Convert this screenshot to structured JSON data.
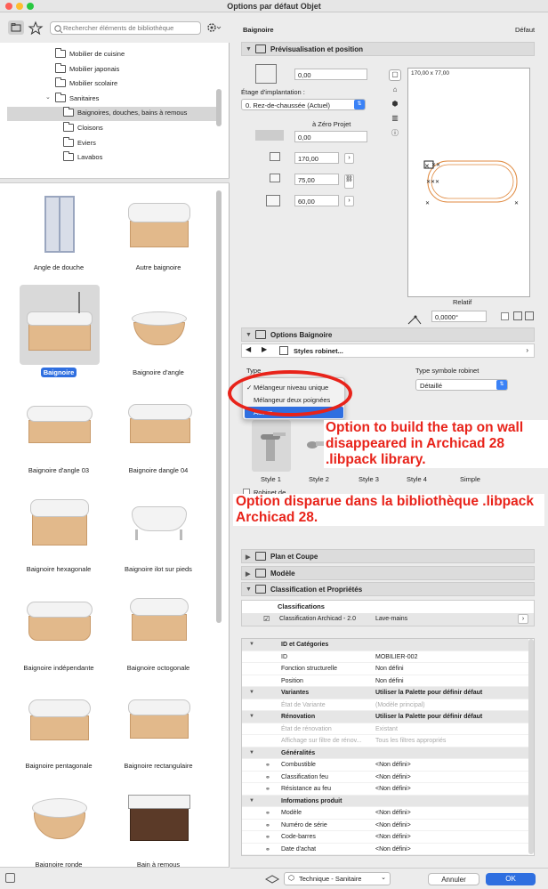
{
  "window": {
    "title": "Options par défaut Objet"
  },
  "library": {
    "search_placeholder": "Rechercher éléments de bibliothèque",
    "tree": [
      {
        "label": "Mobilier de cuisine"
      },
      {
        "label": "Mobilier japonais"
      },
      {
        "label": "Mobilier scolaire"
      },
      {
        "label": "Sanitaires"
      },
      {
        "label": "Baignoires, douches, bains à remous"
      },
      {
        "label": "Cloisons"
      },
      {
        "label": "Eviers"
      },
      {
        "label": "Lavabos"
      }
    ],
    "items": [
      {
        "label": "Angle de douche"
      },
      {
        "label": "Autre baignoire"
      },
      {
        "label": "Baignoire"
      },
      {
        "label": "Baignoire d'angle"
      },
      {
        "label": "Baignoire d'angle 03"
      },
      {
        "label": "Baignoire dangle 04"
      },
      {
        "label": "Baignoire hexagonale"
      },
      {
        "label": "Baignoire ilot sur pieds"
      },
      {
        "label": "Baignoire indépendante"
      },
      {
        "label": "Baignoire octogonale"
      },
      {
        "label": "Baignoire pentagonale"
      },
      {
        "label": "Baignoire rectangulaire"
      },
      {
        "label": "Baignoire ronde"
      },
      {
        "label": "Bain à remous"
      }
    ]
  },
  "header": {
    "object_name": "Baignoire",
    "default_label": "Défaut"
  },
  "preview_section": {
    "title": "Prévisualisation et position",
    "elevation": "0,00",
    "story_label": "Étage d'implantation :",
    "story_value": "0. Rez-de-chaussée (Actuel)",
    "relative_label": "à Zéro Projet",
    "zero_value": "0,00",
    "dim_x": "170,00",
    "dim_y": "75,00",
    "dim_z": "60,00",
    "preview_size": "170,00 x 77,00",
    "relative_btn": "Relatif",
    "angle": "0,0000°"
  },
  "options_section": {
    "title": "Options Baignoire",
    "page_label": "Styles robinet...",
    "type_label": "Type",
    "tap_symbol_label": "Type symbole robinet",
    "tap_symbol_value": "Détaillé",
    "menu": [
      {
        "label": "Mélangeur niveau unique",
        "checked": "✓"
      },
      {
        "label": "Mélangeur deux poignées",
        "checked": ""
      },
      {
        "label": "Aucun",
        "checked": ""
      }
    ],
    "styles": [
      {
        "label": "Style 1"
      },
      {
        "label": "Style 2"
      },
      {
        "label": "Style 3"
      },
      {
        "label": "Style 4"
      },
      {
        "label": "Simple"
      }
    ],
    "wall_tap_label": "Robinet de"
  },
  "annotations": {
    "english": "Option to build the tap on wall disappeared in Archicad 28 .libpack library.",
    "french": "Option disparue dans la bibliothèque .libpack Archicad 28."
  },
  "sections": {
    "plan": "Plan et Coupe",
    "model": "Modèle",
    "classification": "Classification et Propriétés"
  },
  "classifications": {
    "header": "Classifications",
    "system": "Classification Archicad - 2.0",
    "value": "Lave-mains"
  },
  "properties": [
    {
      "type": "group",
      "key": "ID et Catégories",
      "value": ""
    },
    {
      "type": "row",
      "key": "ID",
      "value": "MOBILIER-002"
    },
    {
      "type": "row",
      "key": "Fonction structurelle",
      "value": "Non défini"
    },
    {
      "type": "row",
      "key": "Position",
      "value": "Non défini"
    },
    {
      "type": "group",
      "key": "Variantes",
      "value": "Utiliser la Palette pour définir défaut"
    },
    {
      "type": "muted",
      "key": "État de Variante",
      "value": "(Modèle principal)"
    },
    {
      "type": "group",
      "key": "Rénovation",
      "value": "Utiliser la Palette pour définir défaut"
    },
    {
      "type": "muted",
      "key": "État de rénovation",
      "value": "Existant"
    },
    {
      "type": "muted",
      "key": "Affichage sur filtre de rénov...",
      "value": "Tous les filtres appropriés"
    },
    {
      "type": "group",
      "key": "Généralités",
      "value": ""
    },
    {
      "type": "link",
      "key": "Combustible",
      "value": "<Non défini>"
    },
    {
      "type": "link",
      "key": "Classification feu",
      "value": "<Non défini>"
    },
    {
      "type": "link",
      "key": "Résistance au feu",
      "value": "<Non défini>"
    },
    {
      "type": "group",
      "key": "Informations produit",
      "value": ""
    },
    {
      "type": "link",
      "key": "Modèle",
      "value": "<Non défini>"
    },
    {
      "type": "link",
      "key": "Numéro de série",
      "value": "<Non défini>"
    },
    {
      "type": "link",
      "key": "Code-barres",
      "value": "<Non défini>"
    },
    {
      "type": "link",
      "key": "Date d'achat",
      "value": "<Non défini>"
    }
  ],
  "footer": {
    "layer": "Technique - Sanitaire",
    "cancel": "Annuler",
    "ok": "OK"
  },
  "colors": {
    "accent": "#2f6fe0",
    "annotation": "#e8231a",
    "tub_side": "#e2b98b"
  }
}
